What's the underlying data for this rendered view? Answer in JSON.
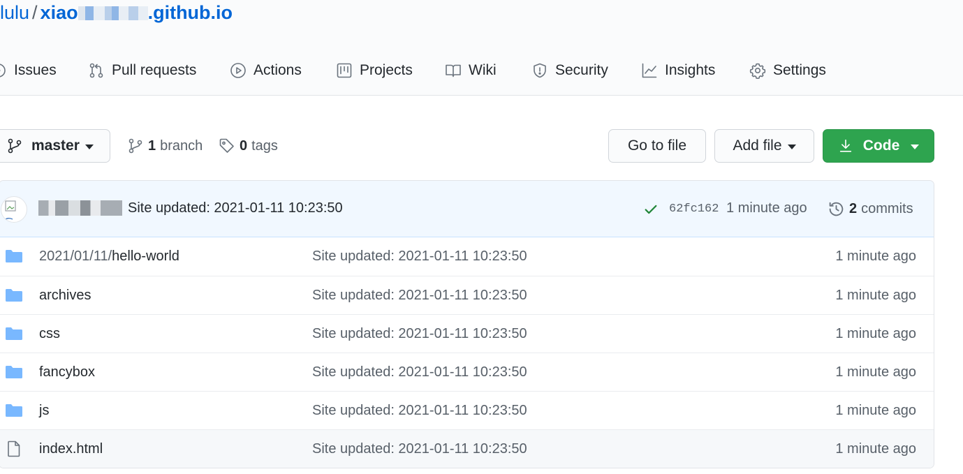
{
  "repo": {
    "owner": "lulu",
    "separator": "/",
    "name_start": "xiao",
    "name_end": ".github.io"
  },
  "nav": {
    "items": [
      {
        "label": "Issues",
        "icon": "issue-opened-icon"
      },
      {
        "label": "Pull requests",
        "icon": "git-pull-request-icon"
      },
      {
        "label": "Actions",
        "icon": "play-icon"
      },
      {
        "label": "Projects",
        "icon": "project-icon"
      },
      {
        "label": "Wiki",
        "icon": "book-icon"
      },
      {
        "label": "Security",
        "icon": "shield-icon"
      },
      {
        "label": "Insights",
        "icon": "graph-icon"
      },
      {
        "label": "Settings",
        "icon": "gear-icon"
      }
    ]
  },
  "toolbar": {
    "branch_label": "master",
    "branch_count": "1",
    "branch_text": "branch",
    "tag_count": "0",
    "tag_text": "tags",
    "go_to_file": "Go to file",
    "add_file": "Add file",
    "code": "Code"
  },
  "commit": {
    "message": "Site updated: 2021-01-11 10:23:50",
    "sha": "62fc162",
    "time": "1 minute ago",
    "count": "2",
    "count_text": "commits",
    "status_color": "#22863a"
  },
  "files": [
    {
      "prefix": "2021/01/11/",
      "name": "hello-world",
      "type": "folder",
      "message": "Site updated: 2021-01-11 10:23:50",
      "time": "1 minute ago"
    },
    {
      "prefix": "",
      "name": "archives",
      "type": "folder",
      "message": "Site updated: 2021-01-11 10:23:50",
      "time": "1 minute ago"
    },
    {
      "prefix": "",
      "name": "css",
      "type": "folder",
      "message": "Site updated: 2021-01-11 10:23:50",
      "time": "1 minute ago"
    },
    {
      "prefix": "",
      "name": "fancybox",
      "type": "folder",
      "message": "Site updated: 2021-01-11 10:23:50",
      "time": "1 minute ago"
    },
    {
      "prefix": "",
      "name": "js",
      "type": "folder",
      "message": "Site updated: 2021-01-11 10:23:50",
      "time": "1 minute ago"
    },
    {
      "prefix": "",
      "name": "index.html",
      "type": "file",
      "message": "Site updated: 2021-01-11 10:23:50",
      "time": "1 minute ago"
    }
  ],
  "colors": {
    "link": "#0366d6",
    "primary_button": "#2ea44f",
    "folder": "#79b8ff",
    "commit_bar": "#f1f8ff"
  }
}
